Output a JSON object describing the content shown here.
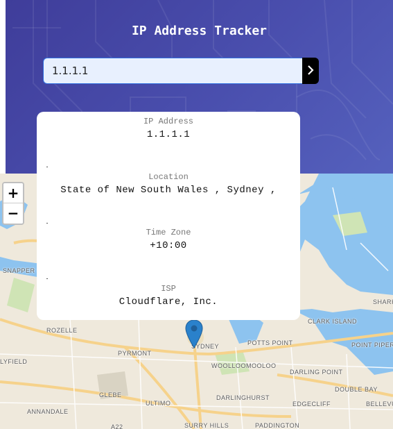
{
  "header": {
    "title": "IP Address Tracker",
    "search": {
      "value": "1.1.1.1",
      "button_icon": "chevron-right-icon"
    }
  },
  "card": {
    "ip": {
      "label": "IP Address",
      "value": "1.1.1.1"
    },
    "location": {
      "label": "Location",
      "value": "State of New South Wales , Sydney ,"
    },
    "timezone": {
      "label": "Time Zone",
      "value": "+10:00"
    },
    "isp": {
      "label": "ISP",
      "value": "Cloudflare, Inc."
    }
  },
  "map": {
    "zoom_in_label": "+",
    "zoom_out_label": "−",
    "marker_icon": "map-pin-icon",
    "place_labels": [
      "SNAPPER H",
      "ROZELLE",
      "PYRMONT",
      "SYDNEY",
      "POTTS POINT",
      "CLARK ISLAND",
      "POINT PIPER",
      "SHARK",
      "WOOLLOOMOOLOO",
      "DARLING POINT",
      "DOUBLE BAY",
      "LYFIELD",
      "GLEBE",
      "ULTIMO",
      "DARLINGHURST",
      "EDGECLIFF",
      "BELLEVU",
      "ANNANDALE",
      "A22",
      "SURRY HILLS",
      "PADDINGTON"
    ]
  },
  "colors": {
    "header_gradient_start": "#3f3d9a",
    "header_gradient_end": "#5561bd",
    "water": "#8dc3ef",
    "land": "#efe9dc",
    "marker": "#2a81cb"
  }
}
